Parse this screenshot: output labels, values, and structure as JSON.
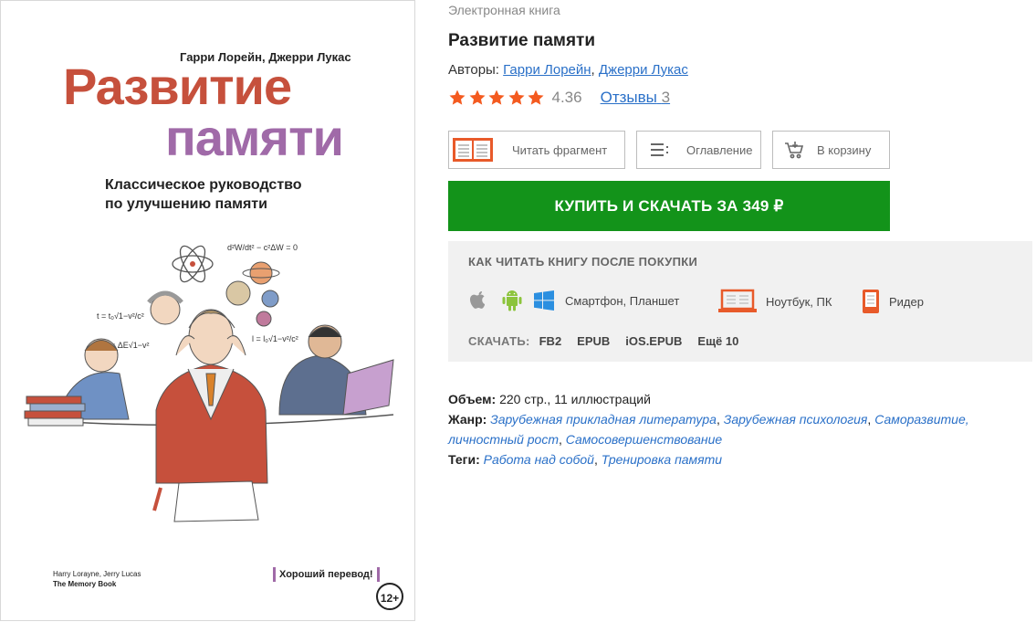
{
  "cover": {
    "authors": "Гарри Лорейн, Джерри Лукас",
    "title_line1": "Развитие",
    "title_line2": "памяти",
    "subtitle_line1": "Классическое руководство",
    "subtitle_line2": "по улучшению памяти",
    "orig_authors": "Harry Lorayne, Jerry Lucas",
    "orig_title": "The Memory Book",
    "badge": "Хороший перевод!",
    "age": "12+"
  },
  "book": {
    "type_label": "Электронная книга",
    "title": "Развитие памяти",
    "authors_label": "Авторы:",
    "authors": [
      "Гарри Лорейн",
      "Джерри Лукас"
    ],
    "rating": "4.36",
    "stars": 5,
    "reviews_label": "Отзывы",
    "reviews_count": "3"
  },
  "actions": {
    "read_fragment": "Читать фрагмент",
    "toc": "Оглавление",
    "to_cart": "В корзину",
    "buy": "КУПИТЬ И СКАЧАТЬ ЗА 349 ₽"
  },
  "howto": {
    "heading": "КАК ЧИТАТЬ КНИГУ ПОСЛЕ ПОКУПКИ",
    "smartphone": "Смартфон, Планшет",
    "laptop": "Ноутбук, ПК",
    "reader": "Ридер",
    "download_label": "СКАЧАТЬ:",
    "formats": [
      "FB2",
      "EPUB",
      "iOS.EPUB",
      "Ещё 10"
    ]
  },
  "meta": {
    "volume_label": "Объем:",
    "volume": "220 стр., 11 иллюстраций",
    "genre_label": "Жанр:",
    "genres": [
      "Зарубежная прикладная литература",
      "Зарубежная психология",
      "Саморазвитие, личностный рост",
      "Самосовершенствование"
    ],
    "tags_label": "Теги:",
    "tags": [
      "Работа над собой",
      "Тренировка памяти"
    ]
  },
  "colors": {
    "accent_green": "#13931a",
    "star_orange": "#f45a1f",
    "link_blue": "#2a70c8"
  }
}
